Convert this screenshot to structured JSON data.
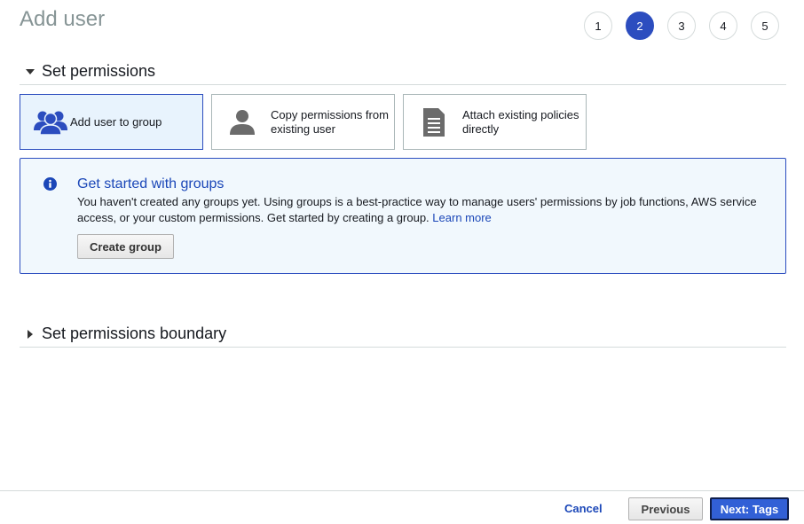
{
  "page": {
    "title": "Add user"
  },
  "wizard": {
    "steps": [
      "1",
      "2",
      "3",
      "4",
      "5"
    ],
    "active_step": "2"
  },
  "permissions": {
    "section_title": "Set permissions",
    "options": [
      {
        "label": "Add user to group",
        "icon": "users-group-icon",
        "selected": true
      },
      {
        "label": "Copy permissions from existing user",
        "icon": "user-icon",
        "selected": false
      },
      {
        "label": "Attach existing policies directly",
        "icon": "document-icon",
        "selected": false
      }
    ]
  },
  "info": {
    "title": "Get started with groups",
    "text": "You haven't created any groups yet. Using groups is a best-practice way to manage users' permissions by job functions, AWS service access, or your custom permissions. Get started by creating a group.",
    "link": "Learn more",
    "button": "Create group",
    "icon": "info-icon"
  },
  "boundary": {
    "section_title": "Set permissions boundary"
  },
  "footer": {
    "cancel": "Cancel",
    "previous": "Previous",
    "next": "Next: Tags"
  },
  "colors": {
    "accent": "#2c4dbf",
    "link": "#1b47b8",
    "info_bg": "#f1f8fd",
    "selected_bg": "#e8f3fd"
  }
}
